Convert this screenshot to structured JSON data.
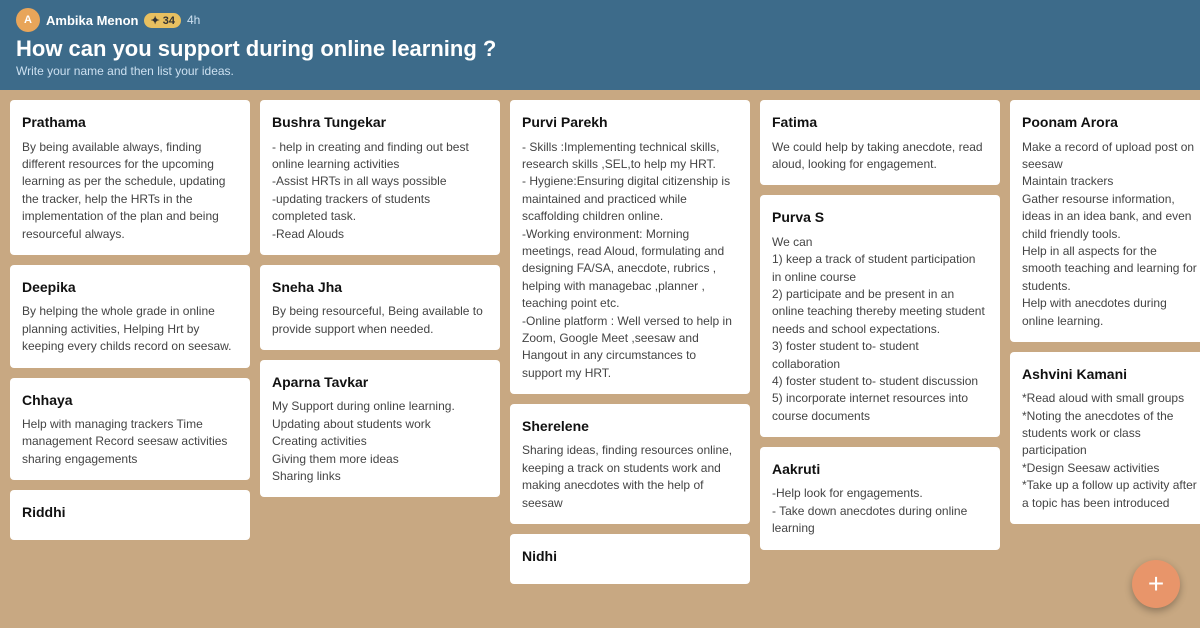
{
  "header": {
    "user_name": "Ambika Menon",
    "badge": "34",
    "time": "4h",
    "title": "How can you support during online learning ?",
    "subtitle": "Write your name and then list your ideas.",
    "avatar_initials": "A"
  },
  "fab_label": "+",
  "cards": [
    {
      "id": "prathama",
      "name": "Prathama",
      "text": "By being available always, finding different resources for the upcoming learning as per the schedule, updating the tracker, help the HRTs in the implementation of the plan and being resourceful always."
    },
    {
      "id": "bushra",
      "name": "Bushra Tungekar",
      "text": "- help in creating and finding out best online learning activities\n-Assist HRTs in all ways possible\n-updating trackers of students completed task.\n-Read Alouds"
    },
    {
      "id": "purvi",
      "name": "Purvi Parekh",
      "text": "- Skills :Implementing technical skills, research skills ,SEL,to help my HRT.\n- Hygiene:Ensuring digital citizenship is maintained and practiced while scaffolding children online.\n-Working environment: Morning meetings, read  Aloud, formulating and designing FA/SA, anecdote, rubrics , helping with managebac ,planner , teaching point etc.\n-Online platform : Well versed to help in Zoom, Google Meet ,seesaw and Hangout in any circumstances to support my HRT."
    },
    {
      "id": "fatima",
      "name": "Fatima",
      "text": "We could help by taking anecdote, read aloud, looking for engagement."
    },
    {
      "id": "poonam",
      "name": "Poonam Arora",
      "text": "Make a record of upload post on seesaw\nMaintain trackers\nGather resourse information, ideas in an idea bank, and even child friendly tools.\nHelp in all aspects for the smooth teaching and learning for students.\nHelp with anecdotes during online learning."
    },
    {
      "id": "deepika",
      "name": "Deepika",
      "text": "By helping the whole grade in online planning activities, Helping Hrt by keeping every childs record on seesaw."
    },
    {
      "id": "sneha",
      "name": "Sneha Jha",
      "text": "By being resourceful,\nBeing available to provide support when needed."
    },
    {
      "id": "purva",
      "name": "Purva S",
      "text": "We can\n1) keep a track of student participation in online course\n2) participate and be present in an online teaching thereby meeting student needs and school expectations.\n3) foster student to- student collaboration\n4) foster student to- student discussion\n5) incorporate internet resources into course documents"
    },
    {
      "id": "ashwini",
      "name": "Ashvini Kamani",
      "text": "*Read aloud with small groups\n*Noting the anecdotes of the students work or class participation\n*Design Seesaw activities\n*Take up a follow up activity after a topic has been introduced"
    },
    {
      "id": "chhaya",
      "name": "Chhaya",
      "text": "Help with managing trackers\nTime management\nRecord seesaw activities\nsharing engagements"
    },
    {
      "id": "aparna",
      "name": "Aparna Tavkar",
      "text": "My Support during online learning.\nUpdating about students work\nCreating activities\nGiving them more ideas\nSharing links"
    },
    {
      "id": "sherelene",
      "name": "Sherelene",
      "text": "Sharing ideas, finding resources online, keeping a track on students work and making anecdotes with the help of seesaw"
    },
    {
      "id": "aakruti",
      "name": "Aakruti",
      "text": "-Help look for engagements.\n- Take down anecdotes during online learning"
    },
    {
      "id": "riddhi",
      "name": "Riddhi",
      "text": ""
    },
    {
      "id": "nidhi",
      "name": "Nidhi",
      "text": ""
    }
  ]
}
